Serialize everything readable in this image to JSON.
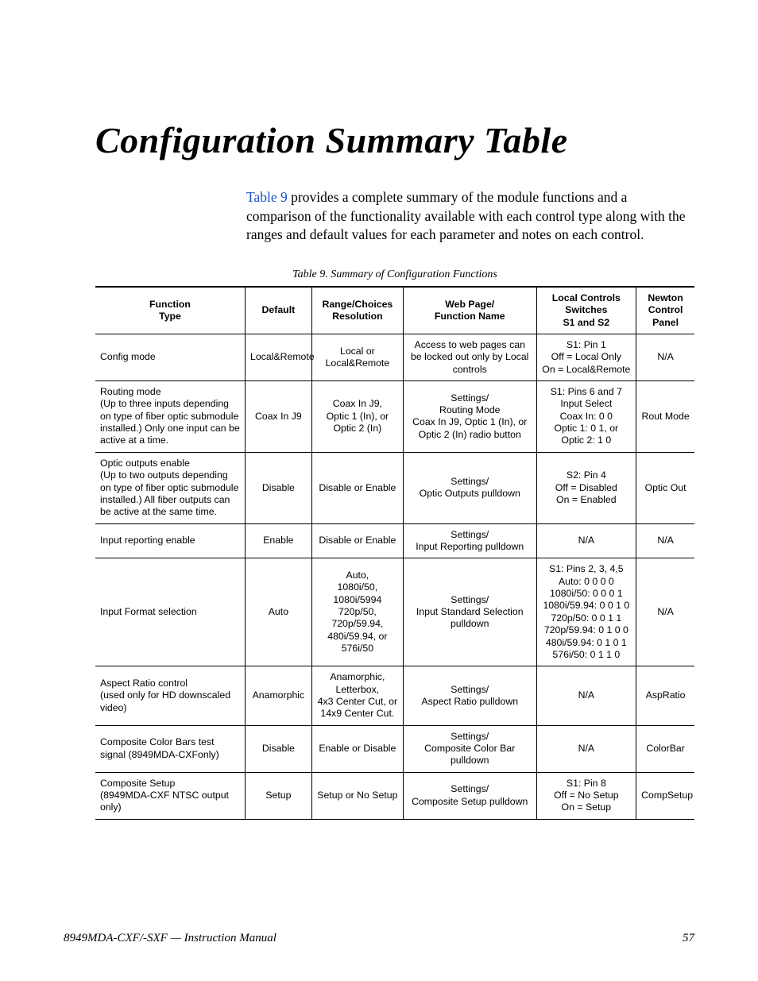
{
  "title": "Configuration Summary Table",
  "intro_link": "Table 9",
  "intro_rest": " provides a complete summary of the module functions and a comparison of the functionality available with each control type along with the ranges and default values for each parameter and notes on each control.",
  "caption": "Table 9.  Summary of Configuration Functions",
  "headers": {
    "ft": "Function\nType",
    "def": "Default",
    "rng": "Range/Choices\nResolution",
    "web": "Web Page/\nFunction Name",
    "loc": "Local Controls\nSwitches\nS1 and S2",
    "new": "Newton\nControl\nPanel"
  },
  "rows": [
    {
      "ft": "Config mode",
      "def": "Local&Remote",
      "rng": "Local or\nLocal&Remote",
      "web": "Access to web pages can be locked out only by Local controls",
      "loc": "S1: Pin 1\nOff = Local Only\nOn = Local&Remote",
      "new": "N/A"
    },
    {
      "ft": "Routing mode\n(Up to three inputs depending on type of fiber optic submodule installed.) Only one input can be active at a time.",
      "def": "Coax In J9",
      "rng": "Coax In J9,\nOptic 1 (In), or\nOptic 2 (In)",
      "web": "Settings/\nRouting Mode\nCoax In J9, Optic 1 (In), or\nOptic 2 (In) radio button",
      "loc": "S1: Pins 6 and 7\nInput Select\nCoax In: 0 0\nOptic 1: 0 1, or\nOptic 2: 1 0",
      "new": "Rout Mode"
    },
    {
      "ft": "Optic outputs enable\n(Up to two outputs depending on type of fiber optic submodule installed.) All fiber outputs can be active at the same time.",
      "def": "Disable",
      "rng": "Disable or Enable",
      "web": "Settings/\nOptic Outputs pulldown",
      "loc": "S2: Pin 4\nOff = Disabled\nOn = Enabled",
      "new": "Optic Out"
    },
    {
      "ft": "Input reporting enable",
      "def": "Enable",
      "rng": "Disable or Enable",
      "web": "Settings/\nInput Reporting pulldown",
      "loc": "N/A",
      "new": "N/A"
    },
    {
      "ft": "Input Format selection",
      "def": "Auto",
      "rng": "Auto,\n1080i/50,\n1080i/5994\n720p/50,\n720p/59.94,\n480i/59.94, or\n576i/50",
      "web": "Settings/\nInput Standard Selection\npulldown",
      "loc": "S1: Pins 2, 3, 4,5\nAuto: 0 0 0 0\n1080i/50: 0 0 0 1\n1080i/59.94: 0 0 1 0\n720p/50: 0 0 1 1\n720p/59.94: 0 1 0 0\n480i/59.94: 0 1 0 1\n576i/50: 0 1 1 0",
      "new": "N/A"
    },
    {
      "ft": "Aspect Ratio control\n(used only for HD downscaled video)",
      "def": "Anamorphic",
      "rng": "Anamorphic,\nLetterbox,\n4x3 Center Cut, or\n14x9 Center Cut.",
      "web": "Settings/\nAspect Ratio pulldown",
      "loc": "N/A",
      "new": "AspRatio"
    },
    {
      "ft": "Composite Color Bars test signal (8949MDA-CXFonly)",
      "def": "Disable",
      "rng": "Enable or Disable",
      "web": "Settings/\nComposite Color Bar\npulldown",
      "loc": "N/A",
      "new": "ColorBar"
    },
    {
      "ft": "Composite Setup\n(8949MDA-CXF NTSC output only)",
      "def": "Setup",
      "rng": "Setup or No Setup",
      "web": "Settings/\nComposite Setup pulldown",
      "loc": "S1: Pin 8\nOff = No Setup\nOn = Setup",
      "new": "CompSetup"
    }
  ],
  "footer_left": "8949MDA-CXF/-SXF  —  Instruction Manual",
  "footer_right": "57"
}
